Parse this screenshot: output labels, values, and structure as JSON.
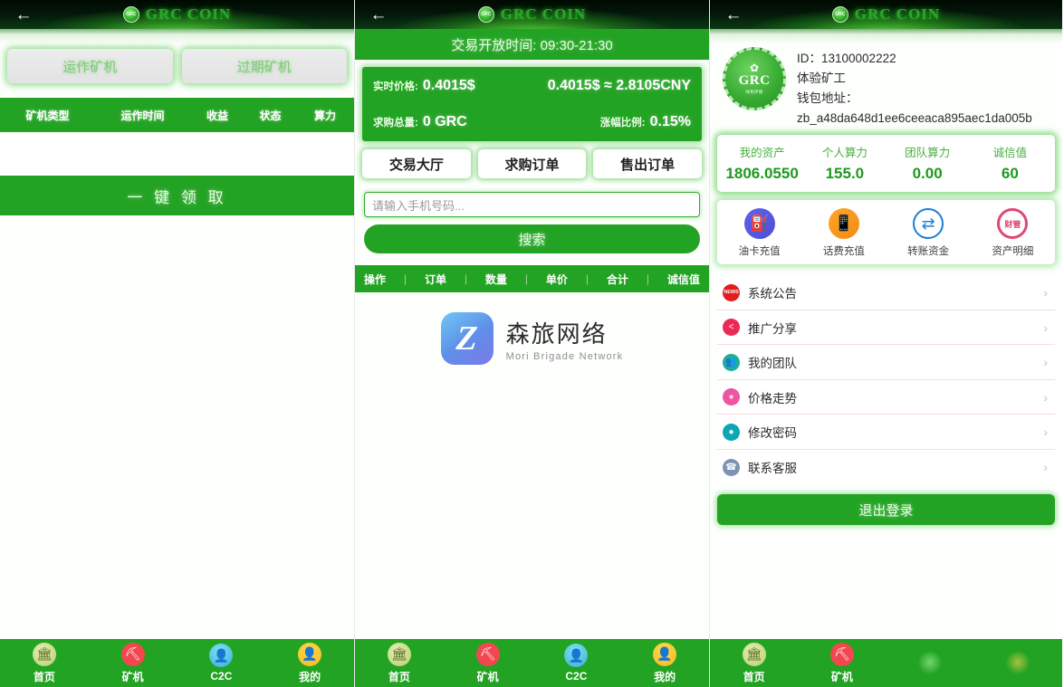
{
  "header": {
    "back_icon": "back-arrow-icon",
    "logo_icon": "grc-logo-icon",
    "logo_text": "GRC",
    "title": "GRC COIN"
  },
  "panel1": {
    "tabs": [
      {
        "label": "运作矿机"
      },
      {
        "label": "过期矿机"
      }
    ],
    "table_headers": [
      "矿机类型",
      "运作时间",
      "收益",
      "状态",
      "算力"
    ],
    "claim_button": "一 键 领 取"
  },
  "panel2": {
    "open_time": "交易开放时间: 09:30-21:30",
    "price_card": {
      "realtime_label": "实时价格:",
      "realtime_value": "0.4015$",
      "convert_value": "0.4015$ ≈ 2.8105CNY",
      "demand_label": "求购总量:",
      "demand_value": "0 GRC",
      "change_label": "涨幅比例:",
      "change_value": "0.15%"
    },
    "buttons": [
      "交易大厅",
      "求购订单",
      "售出订单"
    ],
    "search_placeholder": "请输入手机号码...",
    "search_value": "",
    "search_button": "搜索",
    "table_headers": [
      "操作",
      "订单",
      "数量",
      "单价",
      "合计",
      "诚信值"
    ],
    "brand": {
      "mark_letter": "Z",
      "name_cn": "森旅网络",
      "name_en": "Mori Brigade Network"
    }
  },
  "panel3": {
    "profile": {
      "seal_top": "✿",
      "seal_main": "GRC",
      "seal_sub": "绿色环保",
      "id_line": "ID：13100002222",
      "role": "体验矿工",
      "wallet_label": "钱包地址：",
      "wallet_address": "zb_a48da648d1ee6ceeaca895aec1da005b"
    },
    "stats": [
      {
        "label": "我的资产",
        "value": "1806.0550"
      },
      {
        "label": "个人算力",
        "value": "155.0"
      },
      {
        "label": "团队算力",
        "value": "0.00"
      },
      {
        "label": "诚信值",
        "value": "60"
      }
    ],
    "actions": [
      {
        "label": "油卡充值",
        "icon": "gas-pump-icon",
        "glyph": "⛽",
        "color": "#5f63e8"
      },
      {
        "label": "话费充值",
        "icon": "mobile-phone-icon",
        "glyph": "📱",
        "color": "#f58a12"
      },
      {
        "label": "转账资金",
        "icon": "transfer-arrows-icon",
        "glyph": "⇄",
        "color": "#1a7fd4"
      },
      {
        "label": "资产明细",
        "icon": "finance-circle-icon",
        "glyph": "财管",
        "color": "#e0486f"
      }
    ],
    "menu": [
      {
        "label": "系统公告",
        "icon": "announcement-icon",
        "glyph": "NEWS",
        "color": "#e21d1d"
      },
      {
        "label": "推广分享",
        "icon": "share-icon",
        "glyph": "⤳",
        "color": "#ec2b55"
      },
      {
        "label": "我的团队",
        "icon": "team-icon",
        "glyph": "👥",
        "color": "#1dae9c"
      },
      {
        "label": "价格走势",
        "icon": "price-trend-icon",
        "glyph": "◉",
        "color": "#ee54a0"
      },
      {
        "label": "修改密码",
        "icon": "lock-icon",
        "glyph": "●",
        "color": "#0ba7b5"
      },
      {
        "label": "联系客服",
        "icon": "customer-service-icon",
        "glyph": "☎",
        "color": "#7d93b5"
      }
    ],
    "menu_arrow": "›",
    "logout_button": "退出登录"
  },
  "bottom_nav": {
    "items": [
      {
        "label": "首页",
        "icon": "home-bank-icon",
        "glyph": "🏛"
      },
      {
        "label": "矿机",
        "icon": "miner-icon",
        "glyph": "⛏"
      },
      {
        "label": "C2C",
        "icon": "c2c-icon",
        "glyph": "👤"
      },
      {
        "label": "我的",
        "icon": "profile-icon",
        "glyph": "👤"
      }
    ]
  },
  "colors": {
    "brand_green": "#23a323",
    "header_dark": "#0a3a12",
    "accent_white": "#ffffff"
  }
}
